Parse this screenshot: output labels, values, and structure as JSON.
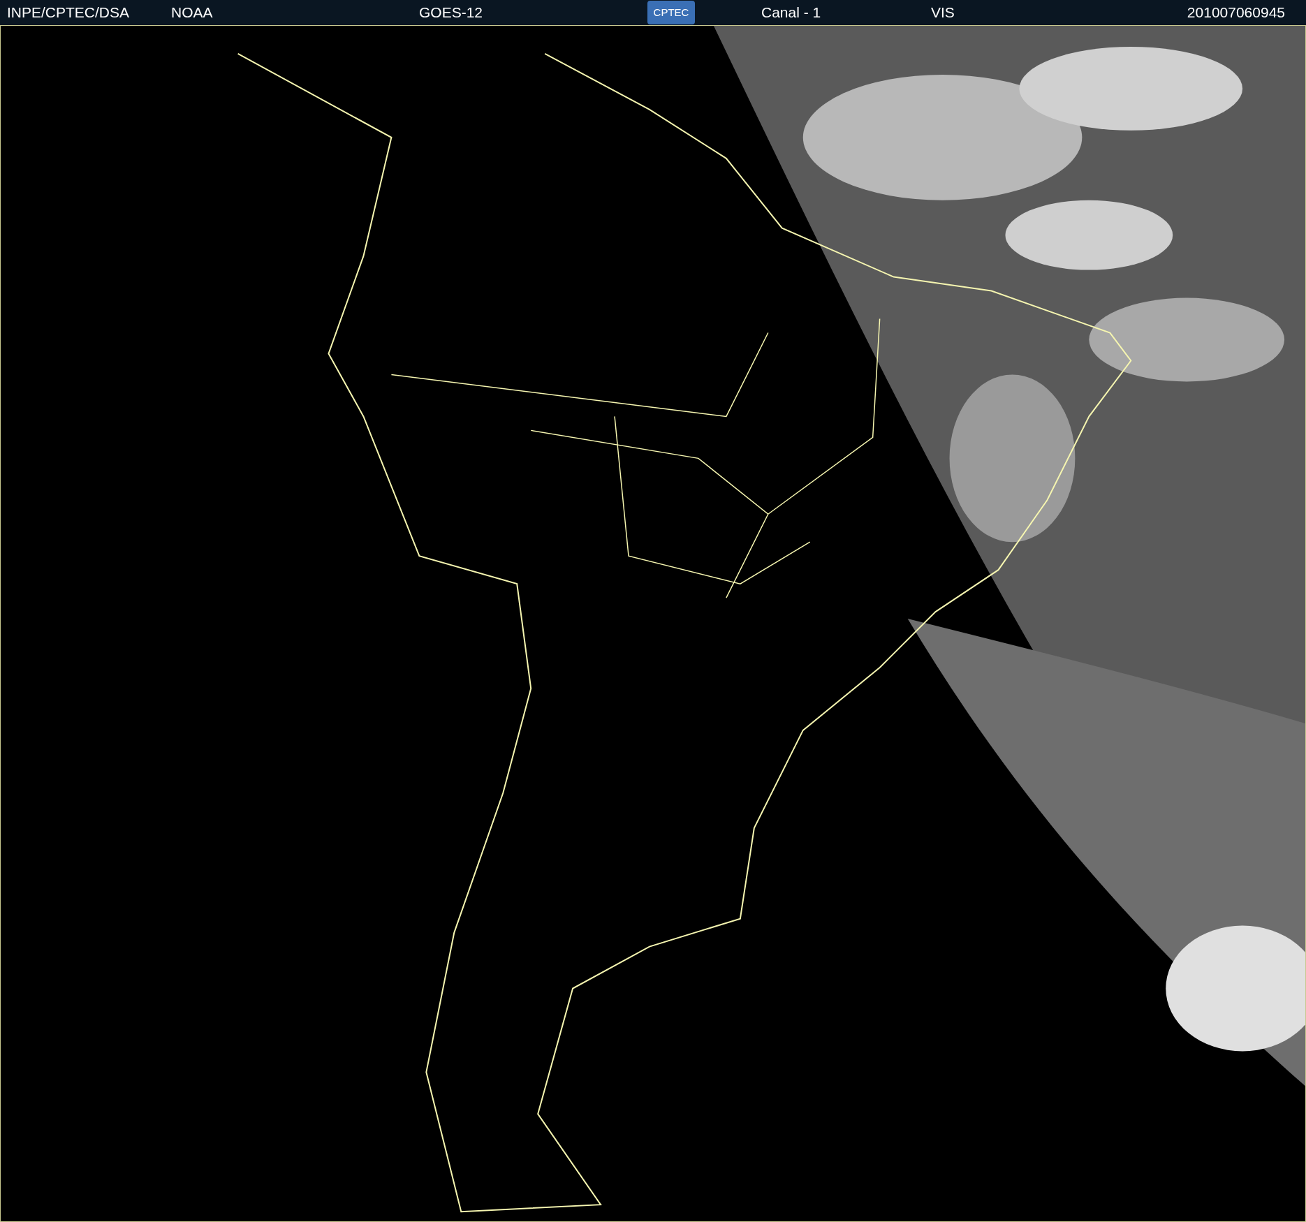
{
  "header": {
    "left": [
      "INPE/CPTEC/DSA",
      "NOAA"
    ],
    "satellite": "GOES-12",
    "logo": "CPTEC",
    "channel": "Canal - 1",
    "band": "VIS",
    "timestamp": "201007060945"
  }
}
